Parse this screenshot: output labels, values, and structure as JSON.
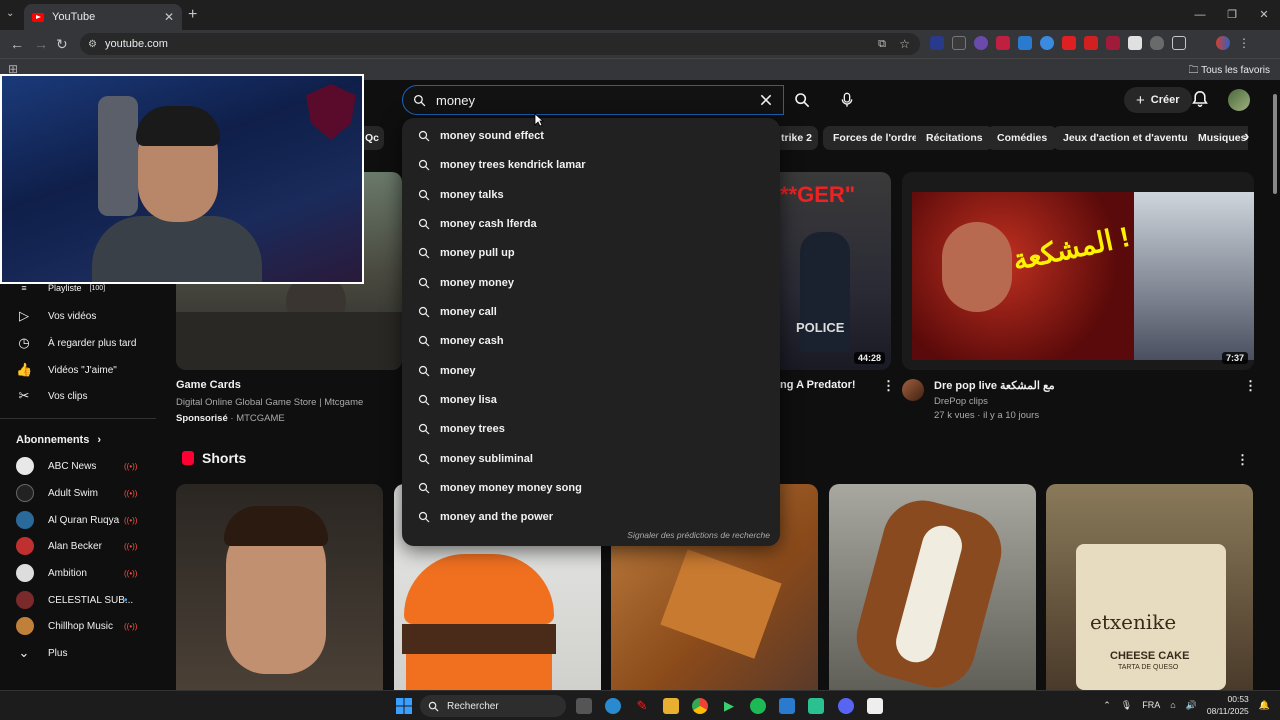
{
  "browser": {
    "tab_title": "YouTube",
    "url": "youtube.com",
    "bookmark_folder": "Tous les favoris"
  },
  "youtube": {
    "search_query": "money",
    "create_label": "Créer",
    "chips": [
      "Qc",
      "trike 2",
      "Forces de l'ordre",
      "Récitations",
      "Comédies",
      "Jeux d'action et d'aventure",
      "Musiques"
    ],
    "suggestions": [
      "money sound effect",
      "money trees kendrick lamar",
      "money talks",
      "money cash lferda",
      "money pull up",
      "money money",
      "money call",
      "money cash",
      "money",
      "money lisa",
      "money trees",
      "money subliminal",
      "money money money song",
      "money and the power"
    ],
    "report_predictions": "Signaler des prédictions de recherche",
    "sidebar": {
      "partial_item": "Playliste",
      "partial_badge": "[100]",
      "items": [
        {
          "label": "Vos vidéos",
          "icon": "video-icon"
        },
        {
          "label": "À regarder plus tard",
          "icon": "clock-icon"
        },
        {
          "label": "Vidéos \"J'aime\"",
          "icon": "thumbs-up-icon"
        },
        {
          "label": "Vos clips",
          "icon": "scissors-icon"
        }
      ],
      "subscriptions_title": "Abonnements",
      "subscriptions": [
        {
          "name": "ABC News",
          "color": "#e8e8e8"
        },
        {
          "name": "Adult Swim",
          "color": "#222222"
        },
        {
          "name": "Al Quran Ruqya",
          "color": "#2a6a9a"
        },
        {
          "name": "Alan Becker",
          "color": "#c03030"
        },
        {
          "name": "Ambition",
          "color": "#dddddd"
        },
        {
          "name": "CELESTIAL SUB...",
          "color": "#7a2a2a"
        },
        {
          "name": "Chillhop Music",
          "color": "#c0803a"
        }
      ],
      "more_label": "Plus"
    },
    "videos": [
      {
        "title": "Game Cards",
        "line1": "Digital Online Global Game Store | Mtcgame",
        "sponsor": "Sponsorisé",
        "channel": "MTCGAME"
      },
      {
        "title": "ng A Predator!",
        "duration": "44:28"
      },
      {
        "title": "Dre pop live مع المشكعة",
        "channel": "DrePop clips",
        "meta": "27 k vues · il y a 10 jours",
        "duration": "7:37",
        "thumb_text": "المشكعة !"
      }
    ],
    "thumb_text_partial": "**GER\"",
    "thumb_text_police": "POLICE",
    "shorts_title": "Shorts",
    "short_can_brand": "etxenike",
    "short_can_sub": "CHEESE CAKE",
    "short_can_sub2": "TARTA DE QUESO"
  },
  "taskbar": {
    "search_label": "Rechercher",
    "language": "FRA",
    "time": "00:53",
    "date": "08/11/2025"
  }
}
